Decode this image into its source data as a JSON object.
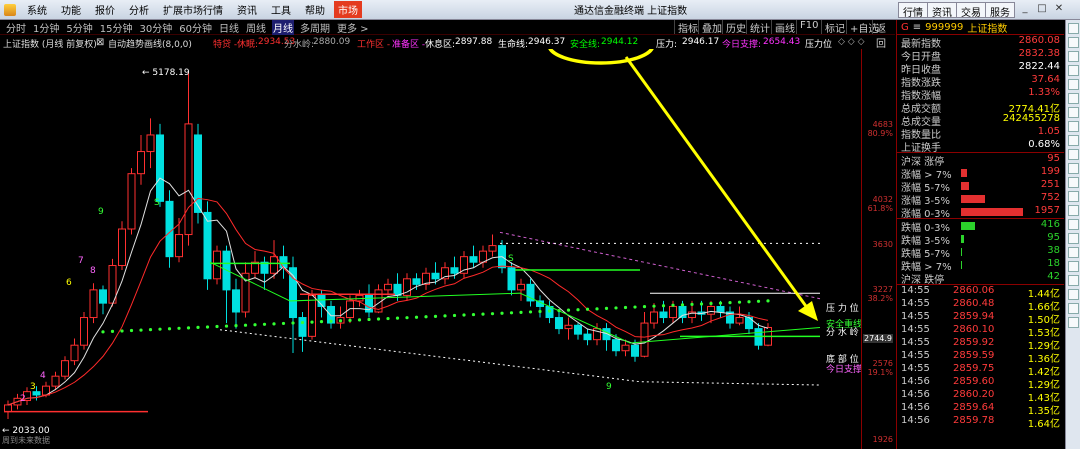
{
  "menu": {
    "items": [
      "系统",
      "功能",
      "报价",
      "分析",
      "扩展市场行情",
      "资讯",
      "工具",
      "帮助"
    ],
    "active": "市场",
    "title": "通达信金融终端  上证指数",
    "right_buttons": [
      "行情",
      "资讯",
      "交易",
      "服务"
    ]
  },
  "tabs": {
    "periods": [
      "分时",
      "1分钟",
      "5分钟",
      "15分钟",
      "30分钟",
      "60分钟",
      "日线",
      "周线",
      "月线",
      "多周期",
      "更多 >"
    ],
    "selected": "月线",
    "right": [
      "指标",
      "叠加",
      "历史",
      "统计",
      "画线",
      "F10",
      "标记",
      "+自选",
      "返回"
    ]
  },
  "info": {
    "name": "上证指数 (月线 前复权)",
    "indicator": "自动趋势画线(8,0,0)",
    "items": [
      {
        "k": "特贷 -",
        "v": "",
        "color": "#ff3030"
      },
      {
        "k": "休眠:",
        "v": "2934.53",
        "color": "#ff3030"
      },
      {
        "k": "分水岭:",
        "v": "2880.09",
        "color": "#aaaaaa"
      },
      {
        "k": "工作区 -",
        "v": "",
        "color": "#ff3030"
      },
      {
        "k": "准备区 -",
        "v": "",
        "color": "#ff33ff"
      },
      {
        "k": "休息区:",
        "v": "2897.88",
        "color": "#ffffff"
      },
      {
        "k": "生命线:",
        "v": "2946.37",
        "color": "#ffffff"
      },
      {
        "k": "安全线:",
        "v": "2944.12",
        "color": "#00ff00"
      },
      {
        "k": "压力:",
        "v": "2946.17",
        "color": "#ffffff"
      },
      {
        "k": "今日支撑:",
        "v": "2654.43",
        "color": "#ff33ff"
      },
      {
        "k": "压力位",
        "v": "",
        "color": "#ffffff"
      }
    ]
  },
  "axis": {
    "labels": [
      {
        "t": "4683",
        "c": "#d03030"
      },
      {
        "t": "80.9%",
        "c": "#d03030"
      },
      {
        "t": "4032",
        "c": "#d03030"
      },
      {
        "t": "61.8%",
        "c": "#d03030"
      },
      {
        "t": "3630",
        "c": "#d03030"
      },
      {
        "t": "3227",
        "c": "#d03030"
      },
      {
        "t": "38.2%",
        "c": "#d03030"
      },
      {
        "t": "2744.9",
        "c": "#ffffff"
      },
      {
        "t": "2576",
        "c": "#d03030"
      },
      {
        "t": "19.1%",
        "c": "#d03030"
      },
      {
        "t": "1926",
        "c": "#d03030"
      }
    ]
  },
  "chart_labels": {
    "high": "5178.19",
    "low": "2033.00",
    "low_note": "周到未来数据",
    "pressure": "压 力 位",
    "safe": "安全重线",
    "divide": "分 水 岭",
    "bottom": "底 部 位",
    "support": "今日支撑"
  },
  "counts": {
    "nine": "9",
    "eight": "8",
    "seven": "7",
    "six": "6",
    "five": "5",
    "four": "4",
    "three": "3",
    "two": "2",
    "one": "1",
    "s": "S"
  },
  "quote": {
    "code": "999999",
    "name": "上证指数",
    "rows": [
      {
        "k": "最新指数",
        "v": "2860.08"
      },
      {
        "k": "今日开盘",
        "v": "2832.38"
      },
      {
        "k": "昨日收盘",
        "v": "2822.44",
        "vc": "#ffffff"
      },
      {
        "k": "指数涨跌",
        "v": "37.64"
      },
      {
        "k": "指数涨幅",
        "v": "1.33%"
      },
      {
        "k": "总成交额",
        "v": "2774.41亿",
        "vc": "#ffff00"
      },
      {
        "k": "总成交量",
        "v": "242455278",
        "vc": "#ffff00"
      },
      {
        "k": "指数量比",
        "v": "1.05"
      },
      {
        "k": "上证换手",
        "v": "0.68%",
        "vc": "#ffffff"
      }
    ],
    "breadth_up": [
      {
        "k": "沪深 涨停",
        "v": "95",
        "w": 0
      },
      {
        "k": "涨幅 > 7%",
        "v": "199",
        "w": 6
      },
      {
        "k": "涨幅 5-7%",
        "v": "251",
        "w": 8
      },
      {
        "k": "涨幅 3-5%",
        "v": "752",
        "w": 24
      },
      {
        "k": "涨幅 0-3%",
        "v": "1957",
        "w": 62
      }
    ],
    "breadth_down": [
      {
        "k": "跌幅 0-3%",
        "v": "416",
        "w": 14
      },
      {
        "k": "跌幅 3-5%",
        "v": "95",
        "w": 3
      },
      {
        "k": "跌幅 5-7%",
        "v": "38",
        "w": 1
      },
      {
        "k": "跌幅 > 7%",
        "v": "18",
        "w": 1
      },
      {
        "k": "沪深 跌停",
        "v": "42",
        "w": 0
      }
    ],
    "ticks": [
      {
        "t": "14:55",
        "p": "2860.06",
        "v": "1.44亿"
      },
      {
        "t": "14:55",
        "p": "2860.48",
        "v": "1.66亿"
      },
      {
        "t": "14:55",
        "p": "2859.94",
        "v": "1.50亿"
      },
      {
        "t": "14:55",
        "p": "2860.10",
        "v": "1.53亿"
      },
      {
        "t": "14:55",
        "p": "2859.92",
        "v": "1.29亿"
      },
      {
        "t": "14:55",
        "p": "2859.59",
        "v": "1.36亿"
      },
      {
        "t": "14:55",
        "p": "2859.75",
        "v": "1.42亿"
      },
      {
        "t": "14:56",
        "p": "2859.60",
        "v": "1.29亿"
      },
      {
        "t": "14:56",
        "p": "2860.20",
        "v": "1.43亿"
      },
      {
        "t": "14:56",
        "p": "2859.64",
        "v": "1.35亿"
      },
      {
        "t": "14:56",
        "p": "2859.78",
        "v": "1.64亿"
      }
    ]
  }
}
